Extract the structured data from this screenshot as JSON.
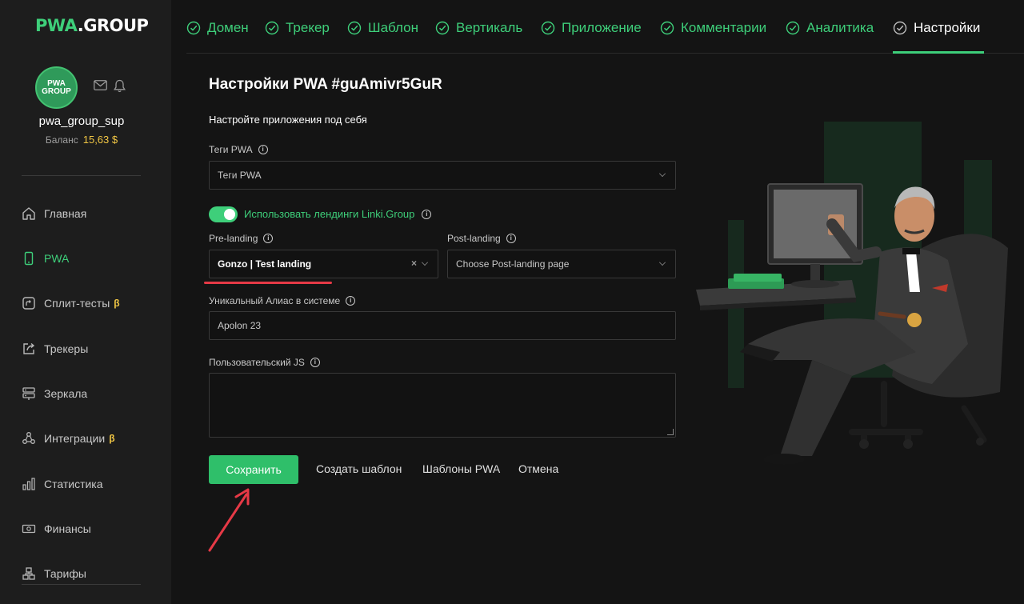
{
  "logo": {
    "text_green": "PWA",
    "text_white": ".GROUP"
  },
  "profile": {
    "avatar_text": "PWA GROUP",
    "username": "pwa_group_sup",
    "balance_label": "Баланс",
    "balance_value": "15,63 $"
  },
  "nav": [
    {
      "label": "Главная",
      "icon": "home-icon"
    },
    {
      "label": "PWA",
      "icon": "phone-icon",
      "active": true
    },
    {
      "label": "Сплит-тесты",
      "icon": "split-icon",
      "badge": "β"
    },
    {
      "label": "Трекеры",
      "icon": "share-icon"
    },
    {
      "label": "Зеркала",
      "icon": "server-icon"
    },
    {
      "label": "Интеграции",
      "icon": "integration-icon",
      "badge": "β"
    },
    {
      "label": "Статистика",
      "icon": "stats-icon"
    },
    {
      "label": "Финансы",
      "icon": "money-icon"
    },
    {
      "label": "Тарифы",
      "icon": "tariff-icon"
    }
  ],
  "tabs": [
    {
      "label": "Домен"
    },
    {
      "label": "Трекер"
    },
    {
      "label": "Шаблон"
    },
    {
      "label": "Вертикаль"
    },
    {
      "label": "Приложение"
    },
    {
      "label": "Комментарии"
    },
    {
      "label": "Аналитика"
    },
    {
      "label": "Настройки",
      "active": true
    }
  ],
  "form": {
    "title": "Настройки PWA #guAmivr5GuR",
    "subtitle": "Настройте приложения под себя",
    "tags_label": "Теги PWA",
    "tags_placeholder": "Теги PWA",
    "toggle_label": "Использовать лендинги Linki.Group",
    "toggle_on": true,
    "prelanding_label": "Pre-landing",
    "prelanding_value": "Gonzo | Test landing",
    "postlanding_label": "Post-landing",
    "postlanding_placeholder": "Choose Post-landing page",
    "alias_label": "Уникальный Алиас в системе",
    "alias_value": "Apolon 23",
    "js_label": "Пользовательский JS",
    "js_value": ""
  },
  "actions": {
    "save": "Сохранить",
    "create_template": "Создать шаблон",
    "templates": "Шаблоны PWA",
    "cancel": "Отмена"
  },
  "colors": {
    "accent": "#3ecf7a",
    "balance": "#f2c744",
    "annotation": "#e63946",
    "bg": "#141414",
    "sidebar": "#1d1d1d"
  }
}
